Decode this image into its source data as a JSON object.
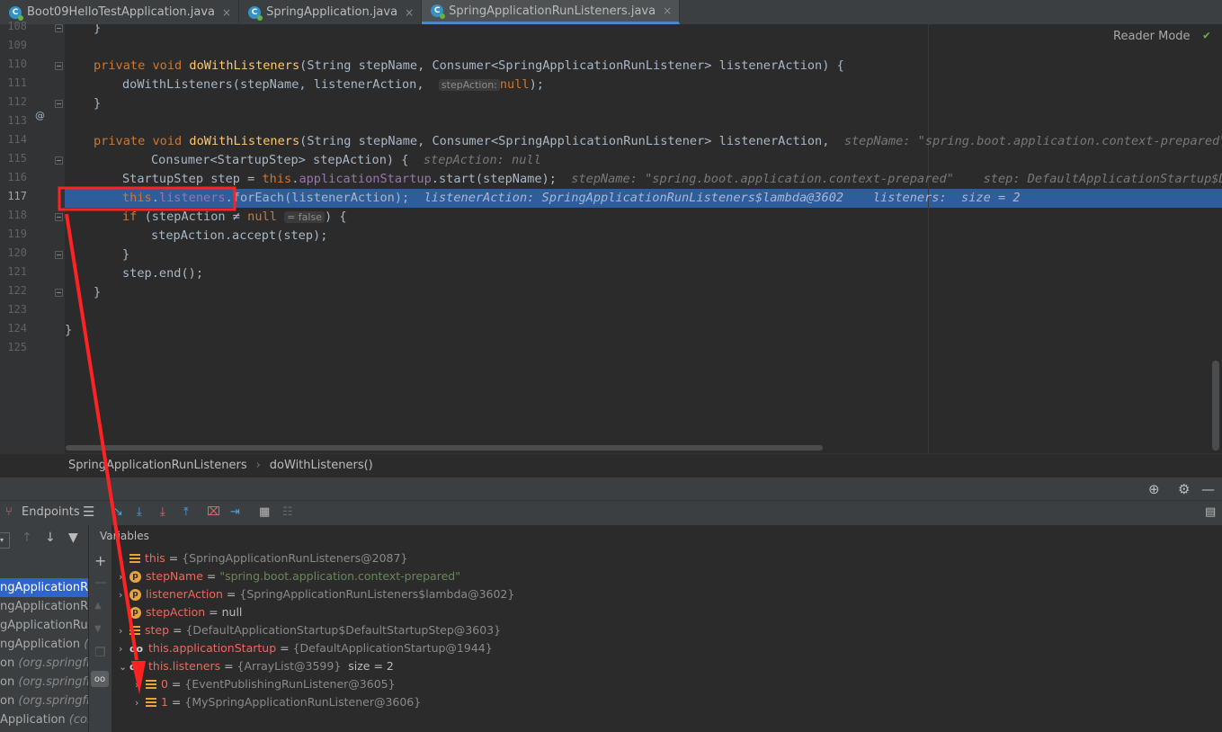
{
  "tabs": [
    {
      "label": "Boot09HelloTestApplication.java",
      "active": false
    },
    {
      "label": "SpringApplication.java",
      "active": false
    },
    {
      "label": "SpringApplicationRunListeners.java",
      "active": true
    }
  ],
  "editor": {
    "reader_mode": "Reader Mode",
    "line_numbers": [
      "108",
      "109",
      "110",
      "111",
      "112",
      "113",
      "114",
      "115",
      "116",
      "117",
      "118",
      "119",
      "120",
      "121",
      "122",
      "123",
      "124",
      "125"
    ],
    "current_line": "117",
    "hints": {
      "l111_inlay": "stepAction:",
      "l114_hint": "stepName: \"spring.boot.application.context-prepared\"",
      "l115_hint": "stepAction: null",
      "l116_hint": "stepName: \"spring.boot.application.context-prepared\"    step: DefaultApplicationStartup$Defa",
      "l117_hint": "listenerAction: SpringApplicationRunListeners$lambda@3602    listeners:  size = 2",
      "l118_inlay": "= false"
    }
  },
  "breadcrumb": {
    "class": "SpringApplicationRunListeners",
    "method": "doWithListeners()"
  },
  "debugger": {
    "endpoints_label": "Endpoints",
    "variables_title": "Variables",
    "frames": [
      {
        "text": "ngApplicationRun",
        "italic": "",
        "selected": true
      },
      {
        "text": "ngApplicationRun",
        "italic": "",
        "selected": false
      },
      {
        "text": "gApplicationRunl",
        "italic": "",
        "selected": false
      },
      {
        "text": "ngApplication ",
        "italic": "(org",
        "selected": false
      },
      {
        "text": "on ",
        "italic": "(org.springfram",
        "selected": false
      },
      {
        "text": "on ",
        "italic": "(org.springfra",
        "selected": false
      },
      {
        "text": "on ",
        "italic": "(org.springfra",
        "selected": false
      },
      {
        "text": "Application ",
        "italic": "(com",
        "selected": false
      }
    ],
    "variables": [
      {
        "name": "this",
        "value": "{SpringApplicationRunListeners@2087}",
        "icon": "bars",
        "expand": "none",
        "indent": 0
      },
      {
        "name": "stepName",
        "value": "\"spring.boot.application.context-prepared\"",
        "icon": "p",
        "expand": "collapsed",
        "indent": 0,
        "string": true
      },
      {
        "name": "listenerAction",
        "value": "{SpringApplicationRunListeners$lambda@3602}",
        "icon": "p",
        "expand": "collapsed",
        "indent": 0
      },
      {
        "name": "stepAction",
        "value": "null",
        "icon": "p",
        "expand": "none",
        "indent": 0,
        "null": true
      },
      {
        "name": "step",
        "value": "{DefaultApplicationStartup$DefaultStartupStep@3603}",
        "icon": "bars",
        "expand": "collapsed",
        "indent": 0
      },
      {
        "name": "this.applicationStartup",
        "value": "{DefaultApplicationStartup@1944}",
        "icon": "oo",
        "expand": "collapsed",
        "indent": 0
      },
      {
        "name": "this.listeners",
        "value": "{ArrayList@3599}",
        "icon": "oo",
        "expand": "expanded",
        "indent": 0,
        "extra": "size = 2"
      },
      {
        "name": "0",
        "value": "{EventPublishingRunListener@3605}",
        "icon": "bars",
        "expand": "collapsed",
        "indent": 1
      },
      {
        "name": "1",
        "value": "{MySpringApplicationRunListener@3606}",
        "icon": "bars",
        "expand": "collapsed",
        "indent": 1
      }
    ]
  },
  "colors": {
    "accent": "#2f65ca",
    "current_line": "#2d5d9b",
    "annotation_red": "#ff2222"
  }
}
